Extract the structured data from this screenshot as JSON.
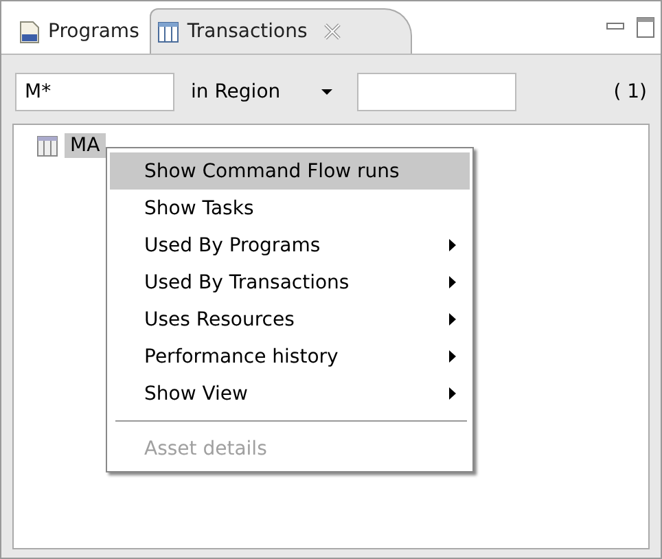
{
  "tabs": [
    {
      "label": "Programs",
      "selected": false,
      "closable": false
    },
    {
      "label": "Transactions",
      "selected": true,
      "closable": true
    }
  ],
  "filter": {
    "name_value": "M*",
    "scope_label": "in Region",
    "count": "( 1)"
  },
  "tree": {
    "items": [
      {
        "label": "MA",
        "selected": true
      }
    ]
  },
  "context_menu": {
    "items": [
      {
        "kind": "item",
        "label": "Show Command Flow runs",
        "selected": true,
        "disabled": false,
        "submenu": false
      },
      {
        "kind": "item",
        "label": "Show Tasks",
        "selected": false,
        "disabled": false,
        "submenu": false
      },
      {
        "kind": "item",
        "label": "Used By Programs",
        "selected": false,
        "disabled": false,
        "submenu": true
      },
      {
        "kind": "item",
        "label": "Used By Transactions",
        "selected": false,
        "disabled": false,
        "submenu": true
      },
      {
        "kind": "item",
        "label": "Uses Resources",
        "selected": false,
        "disabled": false,
        "submenu": true
      },
      {
        "kind": "item",
        "label": "Performance history",
        "selected": false,
        "disabled": false,
        "submenu": true
      },
      {
        "kind": "item",
        "label": "Show View",
        "selected": false,
        "disabled": false,
        "submenu": true
      },
      {
        "kind": "separator"
      },
      {
        "kind": "item",
        "label": "Asset details",
        "selected": false,
        "disabled": true,
        "submenu": false
      }
    ]
  }
}
